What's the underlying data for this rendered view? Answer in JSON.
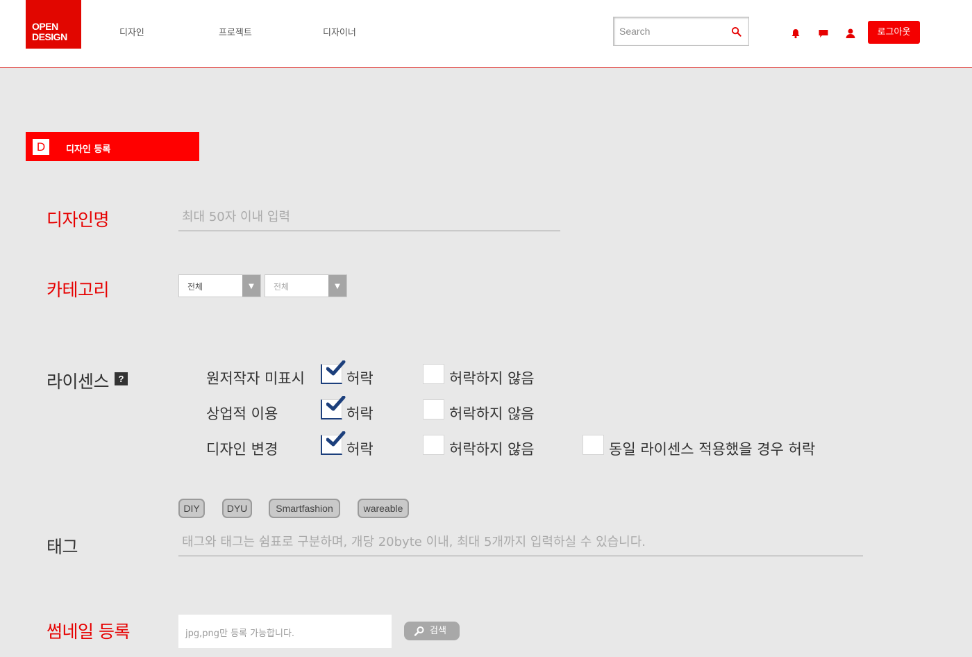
{
  "header": {
    "logo_line1": "OPEN",
    "logo_line2": "DESIGN",
    "nav": [
      "디자인",
      "프로젝트",
      "디자이너"
    ],
    "search_placeholder": "Search",
    "logout_label": "로그아웃"
  },
  "section": {
    "badge": "D",
    "title": "디자인 등록"
  },
  "form": {
    "design_name": {
      "label": "디자인명",
      "placeholder": "최대 50자 이내 입력"
    },
    "category": {
      "label": "카테고리",
      "select1": "전체",
      "select2": "전체"
    },
    "license": {
      "label": "라이센스",
      "help": "?",
      "rows": [
        {
          "label": "원저작자 미표시",
          "allow": "허락",
          "deny": "허락하지 않음"
        },
        {
          "label": "상업적 이용",
          "allow": "허락",
          "deny": "허락하지 않음"
        },
        {
          "label": "디자인 변경",
          "allow": "허락",
          "deny": "허락하지 않음",
          "extra": "동일 라이센스 적용했을 경우 허락"
        }
      ]
    },
    "tags": {
      "label": "태그",
      "items": [
        "DIY",
        "DYU",
        "Smartfashion",
        "wareable"
      ],
      "placeholder": "태그와 태그는 쉼표로 구분하며, 개당 20byte 이내, 최대 5개까지 입력하실 수 있습니다."
    },
    "thumbnail": {
      "label": "썸네일 등록",
      "placeholder": "jpg,png만 등록 가능합니다.",
      "button": "검색"
    }
  },
  "colors": {
    "brand_red": "#e60000",
    "check_blue": "#1c3f7c"
  }
}
